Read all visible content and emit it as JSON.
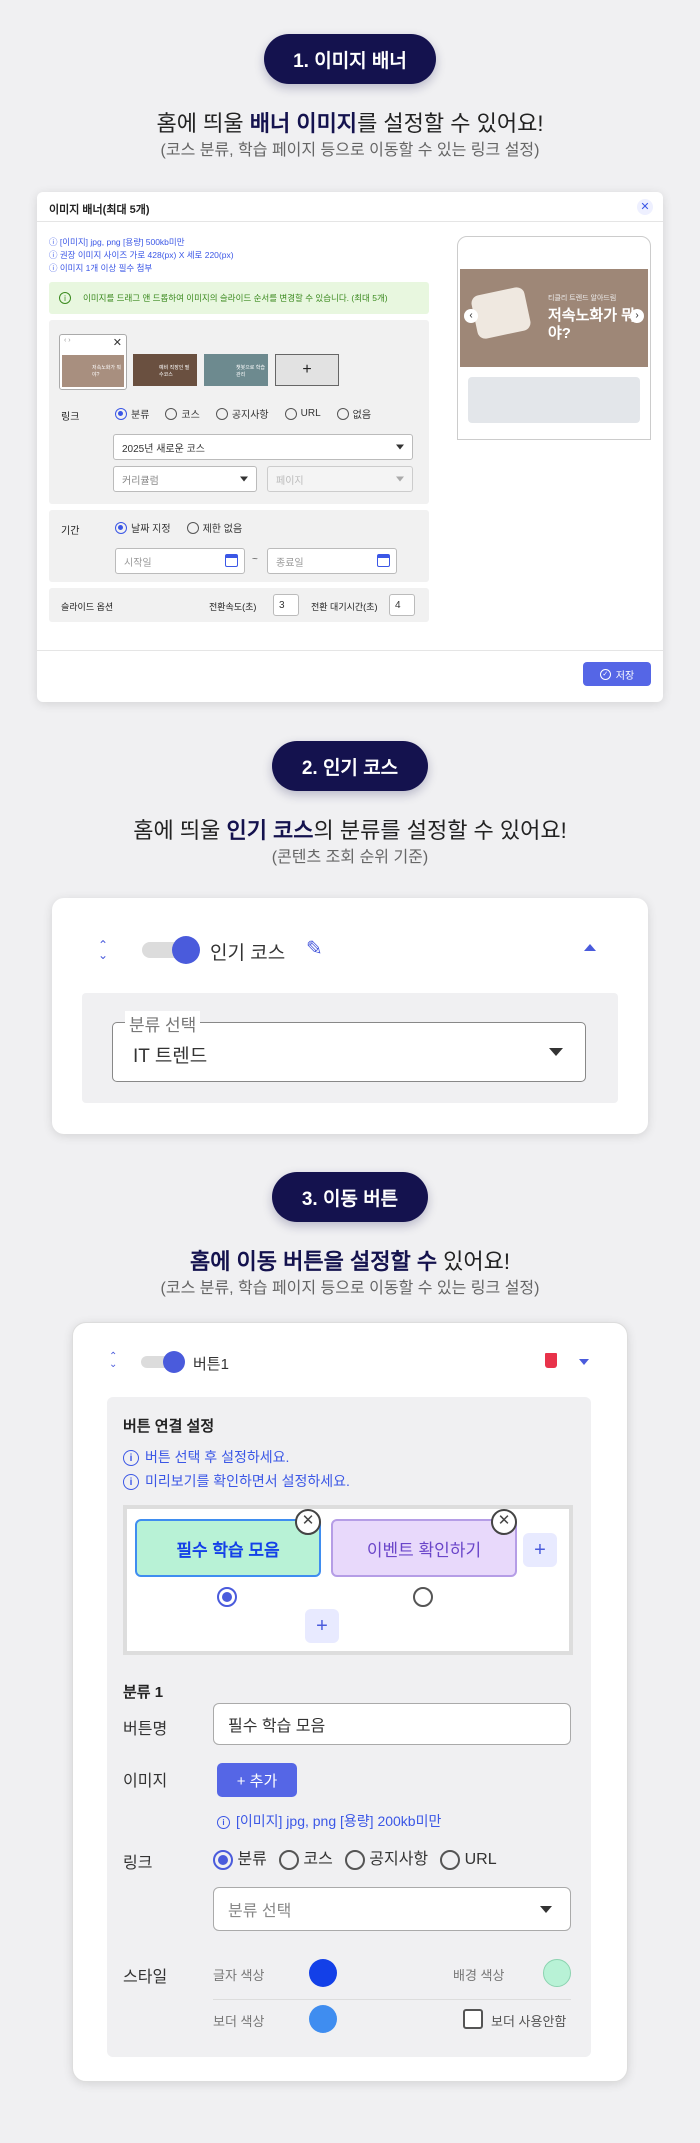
{
  "section1": {
    "pill": "1. 이미지 배너",
    "headline_pre": "홈에 띄울 ",
    "headline_bold": "배너 이미지",
    "headline_post": "를 설정할 수 있어요!",
    "sub": "(코스 분류, 학습 페이지 등으로 이동할 수 있는 링크 설정)",
    "modal": {
      "title": "이미지 배너(최대 5개)",
      "info1": "ⓘ [이미지] jpg, png   [용량] 500kb미만",
      "info2": "ⓘ 권장 이미지 사이즈 가로 428(px) X 세로 220(px)",
      "info3": "ⓘ 이미지 1개 이상 필수 첨부",
      "notice": "이미지를 드래그 앤 드롭하여 이미지의 슬라이드 순서를 변경할 수 있습니다. (최대 5개)",
      "thumb1_text": "저속노화가 뭐야?",
      "thumb2_text": "예비 직장인 필수코스",
      "thumb3_text": "챗봇으로 학습관리",
      "add_symbol": "+",
      "link_label": "링크",
      "link_options": [
        "분류",
        "코스",
        "공지사항",
        "URL",
        "없음"
      ],
      "link_selected": "분류",
      "course_select": "2025년 새로운 코스",
      "curriculum_select": "커리큘럼",
      "page_select": "페이지",
      "period_label": "기간",
      "period_options": [
        "날짜 지정",
        "제한 없음"
      ],
      "period_selected": "날짜 지정",
      "start_placeholder": "시작일",
      "end_placeholder": "종료일",
      "tilde": "~",
      "slide_label": "슬라이드 옵션",
      "speed_label": "전환속도(초)",
      "speed_value": "3",
      "wait_label": "전환 대기시간(초)",
      "wait_value": "4",
      "save": "저장",
      "preview_badge": "티클리 트렌드 알아드림",
      "preview_title": "저속노화가 뭐야?"
    }
  },
  "section2": {
    "pill": "2. 인기 코스",
    "headline_pre": "홈에 띄울 ",
    "headline_bold": "인기 코스",
    "headline_post": "의 분류를 설정할 수 있어요!",
    "sub": "(콘텐츠 조회 순위 기준)",
    "toggle_label": "인기 코스",
    "field_legend": "분류 선택",
    "field_value": "IT 트렌드"
  },
  "section3": {
    "pill": "3. 이동 버튼",
    "headline_bold1": "홈에 이동 버튼을 설정할 수",
    "headline_post": " 있어요!",
    "sub": "(코스 분류, 학습 페이지 등으로 이동할 수 있는 링크 설정)",
    "toggle_label": "버튼1",
    "panel_title": "버튼 연결 설정",
    "info1": "버튼 선택 후 설정하세요.",
    "info2": "미리보기를 확인하면서 설정하세요.",
    "btn1": "필수 학습 모음",
    "btn2": "이벤트 확인하기",
    "plus": "+",
    "group_title": "분류 1",
    "name_label": "버튼명",
    "name_value": "필수 학습 모음",
    "image_label": "이미지",
    "add_button": "+ 추가",
    "image_info": "[이미지] jpg, png   [용량] 200kb미만",
    "link_label": "링크",
    "link_options": [
      "분류",
      "코스",
      "공지사항",
      "URL"
    ],
    "link_selected": "분류",
    "category_placeholder": "분류 선택",
    "style_label": "스타일",
    "text_color_label": "글자 색상",
    "bg_color_label": "배경 색상",
    "border_color_label": "보더 색상",
    "no_border_label": "보더 사용안함",
    "text_color": "#1340e8",
    "bg_color": "#b8f2d6",
    "border_color": "#3f8df0"
  },
  "colors": {
    "navy": "#14124e",
    "accent": "#4a5bdc"
  }
}
